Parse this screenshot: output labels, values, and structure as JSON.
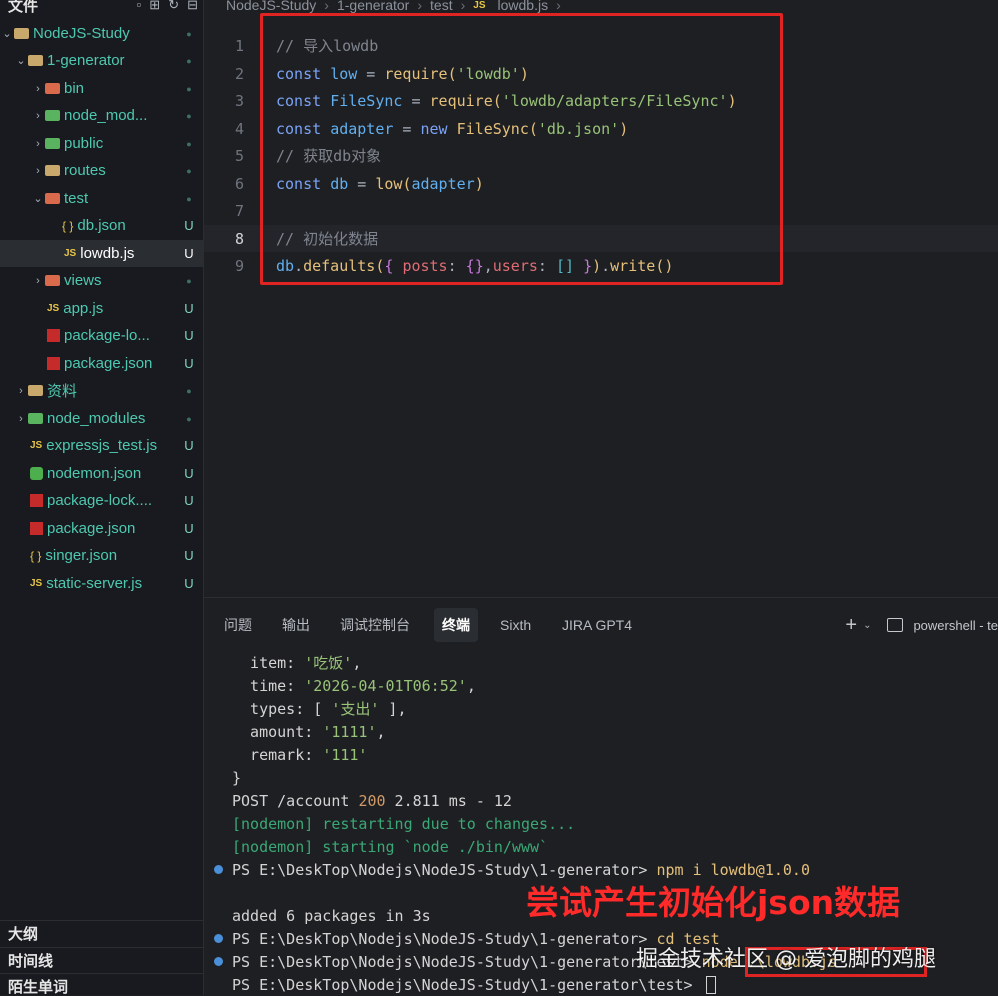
{
  "explorer": {
    "title": "文件",
    "items": [
      {
        "label": "NodeJS-Study",
        "status": "●",
        "kind": "root"
      },
      {
        "label": "1-generator",
        "status": "●",
        "kind": "folder"
      },
      {
        "label": "bin",
        "status": "●",
        "kind": "folder"
      },
      {
        "label": "node_mod...",
        "status": "●",
        "kind": "folder"
      },
      {
        "label": "public",
        "status": "●",
        "kind": "folder"
      },
      {
        "label": "routes",
        "status": "●",
        "kind": "folder"
      },
      {
        "label": "test",
        "status": "●",
        "kind": "folder"
      },
      {
        "label": "db.json",
        "status": "U",
        "kind": "json"
      },
      {
        "label": "lowdb.js",
        "status": "U",
        "kind": "js"
      },
      {
        "label": "views",
        "status": "●",
        "kind": "folder"
      },
      {
        "label": "app.js",
        "status": "U",
        "kind": "js"
      },
      {
        "label": "package-lo...",
        "status": "U",
        "kind": "npm"
      },
      {
        "label": "package.json",
        "status": "U",
        "kind": "npm"
      },
      {
        "label": "资料",
        "status": "●",
        "kind": "folder"
      },
      {
        "label": "node_modules",
        "status": "●",
        "kind": "folder"
      },
      {
        "label": "expressjs_test.js",
        "status": "U",
        "kind": "js"
      },
      {
        "label": "nodemon.json",
        "status": "U",
        "kind": "node"
      },
      {
        "label": "package-lock....",
        "status": "U",
        "kind": "npm"
      },
      {
        "label": "package.json",
        "status": "U",
        "kind": "npm"
      },
      {
        "label": "singer.json",
        "status": "U",
        "kind": "json"
      },
      {
        "label": "static-server.js",
        "status": "U",
        "kind": "js"
      }
    ],
    "sections": [
      "大纲",
      "时间线",
      "陌生单词"
    ]
  },
  "breadcrumb": [
    "NodeJS-Study",
    "1-generator",
    "test",
    "lowdb.js"
  ],
  "editor": {
    "line_numbers": [
      "1",
      "2",
      "3",
      "4",
      "5",
      "6",
      "7",
      "8",
      "9"
    ],
    "lines": [
      "// 导入lowdb",
      "const low = require('lowdb')",
      "const FileSync = require('lowdb/adapters/FileSync')",
      "const adapter = new FileSync('db.json')",
      "// 获取db对象",
      "const db = low(adapter)",
      "",
      "// 初始化数据",
      "db.defaults({ posts: {},users: [] }).write()"
    ]
  },
  "panel": {
    "tabs": [
      "问题",
      "输出",
      "调试控制台",
      "终端",
      "Sixth",
      "JIRA GPT4"
    ],
    "active_tab": "终端",
    "shell": "powershell - te"
  },
  "terminal": {
    "lines": [
      "  item: '吃饭',",
      "  time: '2026-04-01T06:52',",
      "  types: [ '支出' ],",
      "  amount: '1111',",
      "  remark: '111'",
      "}",
      "POST /account 200 2.811 ms - 12",
      "[nodemon] restarting due to changes...",
      "[nodemon] starting `node ./bin/www`",
      "PS E:\\DeskTop\\Nodejs\\NodeJS-Study\\1-generator> npm i lowdb@1.0.0",
      "",
      "added 6 packages in 3s",
      "PS E:\\DeskTop\\Nodejs\\NodeJS-Study\\1-generator> cd test",
      "PS E:\\DeskTop\\Nodejs\\NodeJS-Study\\1-generator\\test> node .\\lowdb.js",
      "PS E:\\DeskTop\\Nodejs\\NodeJS-Study\\1-generator\\test> "
    ]
  },
  "annotation": "尝试产生初始化json数据",
  "watermark": "掘金技术社区 @ 爱泡脚的鸡腿"
}
